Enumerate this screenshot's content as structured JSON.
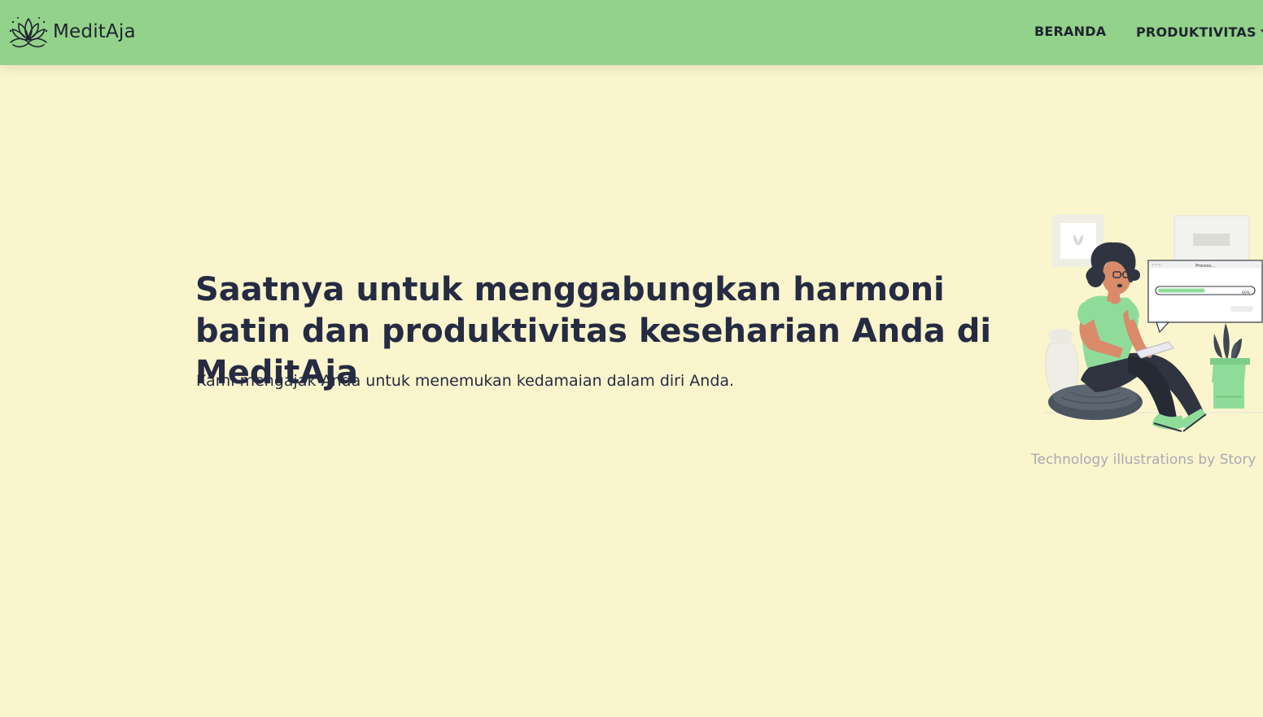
{
  "navbar": {
    "brand_name": "MeditAja",
    "brand_logo": "lotus-icon",
    "links": [
      {
        "label": "BERANDA"
      },
      {
        "label": "PRODUKTIVITAS",
        "icon": "chevron-down-icon"
      }
    ]
  },
  "hero": {
    "title": "Saatnya untuk menggabungkan harmoni batin dan produktivitas keseharian Anda di MeditAja",
    "subtitle": "Kami mengajak Anda untuk menemukan kedamaian dalam diri Anda.",
    "illustration": {
      "window_title": "Process...",
      "progress_percent_label": "60%",
      "progress_value": 0.6
    },
    "credit": "Technology illustrations by Story"
  },
  "colors": {
    "navbar": "#93d28a",
    "background": "#fbf5cd",
    "text": "#252b42",
    "accent_green": "#8fdc9a",
    "credit_text": "#a7a9b7"
  }
}
